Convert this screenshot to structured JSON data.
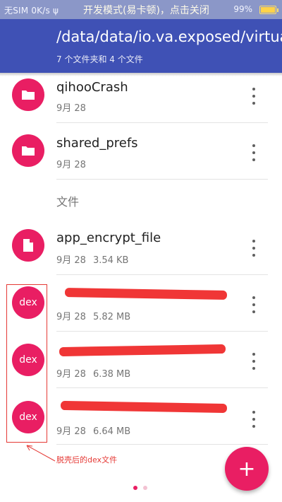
{
  "status_bar": {
    "left": "无SIM 0K/s ψ",
    "center": "开发模式(易卡顿)，点击关闭",
    "right": "99%",
    "battery_level": 0.99
  },
  "header": {
    "path": "/data/data/io.va.exposed/virtual/da",
    "subtitle": "7 个文件夹和 4 个文件"
  },
  "section_label": "文件",
  "rows": [
    {
      "icon": "folder-icon",
      "name": "qihooCrash",
      "date": "9月 28",
      "size": ""
    },
    {
      "icon": "folder-icon",
      "name": "shared_prefs",
      "date": "9月 28",
      "size": ""
    },
    {
      "icon": "file-icon",
      "name": "app_encrypt_file",
      "date": "9月 28",
      "size": "3.54 KB"
    },
    {
      "icon": "dex",
      "name": "",
      "date": "9月 28",
      "size": "5.82 MB",
      "avatar_text": "dex"
    },
    {
      "icon": "dex",
      "name": "",
      "date": "9月 28",
      "size": "6.38 MB",
      "avatar_text": "dex"
    },
    {
      "icon": "dex",
      "name": "",
      "date": "9月 28",
      "size": "6.64 MB",
      "avatar_text": "dex"
    }
  ],
  "annotation": "脱壳后的dex文件",
  "fab_label": "+",
  "colors": {
    "primary": "#3f51b5",
    "accent": "#e91e63",
    "annotation": "#e53935"
  }
}
